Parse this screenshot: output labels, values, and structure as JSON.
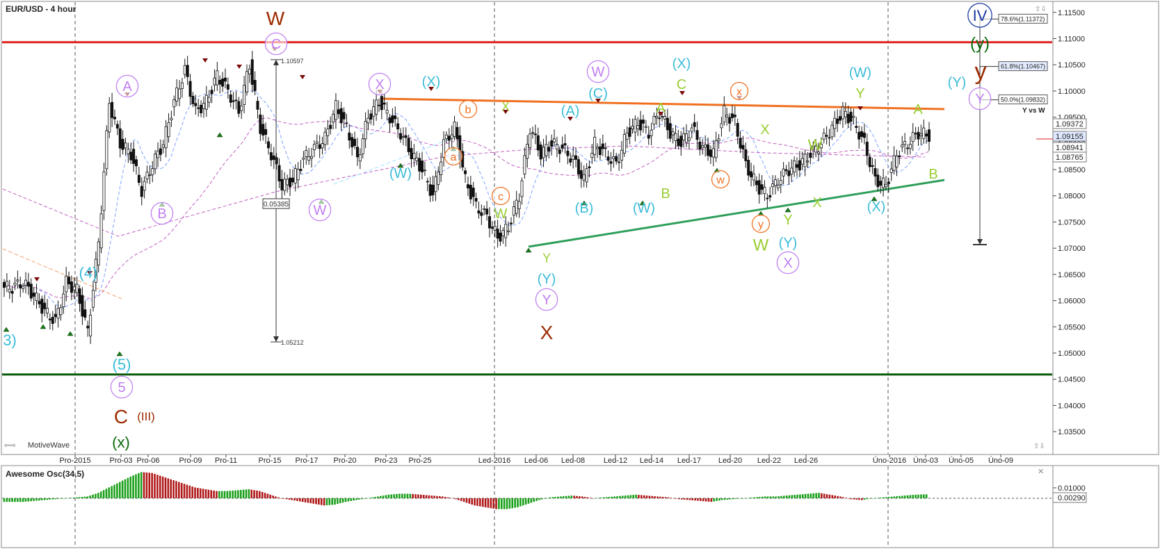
{
  "chart_data": {
    "type": "candlestick",
    "title": "EUR/USD - 4 hour",
    "watermark": "MotiveWave",
    "ylim": [
      1.0325,
      1.1155
    ],
    "y_ticks": [
      "1.11500",
      "1.11000",
      "1.10500",
      "1.10000",
      "1.09500",
      "1.09000",
      "1.08500",
      "1.08000",
      "1.07500",
      "1.07000",
      "1.06500",
      "1.06000",
      "1.05500",
      "1.05000",
      "1.04500",
      "1.04000",
      "1.03500"
    ],
    "x_ticks": [
      "Pro-2015",
      "Pro-03",
      "Pro-06",
      "Pro-09",
      "Pro-11",
      "Pro-15",
      "Pro-17",
      "Pro-20",
      "Pro-23",
      "Pro-25",
      "Led-2016",
      "Led-06",
      "Led-08",
      "Led-12",
      "Led-14",
      "Led-17",
      "Led-20",
      "Led-22",
      "Led-26",
      "Úno-2016",
      "Úno-03",
      "Úno-05",
      "Úno-09"
    ],
    "price_labels": [
      {
        "text": "1.09372",
        "color": "#ffffff"
      },
      {
        "text": "1.09155",
        "color": "#dfe8ff"
      },
      {
        "text": "1.08941",
        "color": "#ffffff"
      },
      {
        "text": "1.08765",
        "color": "#ffffff"
      }
    ],
    "fib_levels": [
      {
        "text": "78.6%(1.11372)",
        "price": 1.11372
      },
      {
        "text": "61.8%(1.10467)",
        "price": 1.10467
      },
      {
        "text": "50.0%(1.09832)",
        "price": 1.09832
      }
    ],
    "fib_caption": "Y vs W",
    "measure": {
      "high": "1.10597",
      "low": "1.05212",
      "diff": "0.05385"
    },
    "lines": [
      {
        "name": "resistance-red",
        "color": "#e02020",
        "y": 1.1093
      },
      {
        "name": "support-darkgreen",
        "color": "#0a5a0a",
        "y": 1.0459
      },
      {
        "name": "triangle-top-orange",
        "color": "#f07020",
        "from": 1.0985,
        "to": 1.0966
      },
      {
        "name": "triangle-bottom-green",
        "color": "#2e9e5a",
        "from": 1.071,
        "to": 1.0834
      }
    ],
    "closes": [
      1.0625,
      1.0635,
      1.061,
      1.058,
      1.056,
      1.0635,
      1.062,
      1.054,
      1.071,
      1.098,
      1.09,
      1.088,
      1.081,
      1.086,
      1.09,
      1.098,
      1.104,
      1.096,
      1.098,
      1.103,
      1.1,
      1.096,
      1.105,
      1.093,
      1.088,
      1.082,
      1.083,
      1.087,
      1.089,
      1.091,
      1.097,
      1.093,
      1.087,
      1.095,
      1.098,
      1.095,
      1.092,
      1.088,
      1.085,
      1.08,
      1.09,
      1.093,
      1.083,
      1.078,
      1.076,
      1.072,
      1.074,
      1.08,
      1.093,
      1.088,
      1.09,
      1.089,
      1.087,
      1.083,
      1.09,
      1.088,
      1.086,
      1.092,
      1.094,
      1.092,
      1.096,
      1.092,
      1.09,
      1.093,
      1.089,
      1.088,
      1.096,
      1.094,
      1.086,
      1.082,
      1.08,
      1.083,
      1.085,
      1.086,
      1.088,
      1.09,
      1.093,
      1.096,
      1.094,
      1.09,
      1.083,
      1.082,
      1.088,
      1.09,
      1.092,
      1.0915
    ],
    "oscillator": {
      "name": "Awesome Osc(34,5)",
      "ticks": [
        "0.01000",
        "0.00290"
      ],
      "values": [
        -0.002,
        -0.002,
        -0.0015,
        -0.001,
        -0.0005,
        0.0,
        0.0005,
        0.001,
        0.003,
        0.006,
        0.009,
        0.012,
        0.0145,
        0.014,
        0.012,
        0.01,
        0.008,
        0.006,
        0.005,
        0.004,
        0.004,
        0.0045,
        0.005,
        0.004,
        0.002,
        0.0,
        -0.001,
        -0.002,
        -0.003,
        -0.004,
        -0.0035,
        -0.002,
        -0.001,
        0.0,
        0.001,
        0.002,
        0.0025,
        0.0025,
        0.002,
        0.0015,
        0.001,
        0.0,
        -0.002,
        -0.004,
        -0.005,
        -0.006,
        -0.006,
        -0.005,
        -0.003,
        -0.001,
        0.0005,
        0.001,
        0.0015,
        0.001,
        0.0,
        0.0005,
        0.001,
        0.0015,
        0.002,
        0.0015,
        0.001,
        0.0005,
        -0.0005,
        -0.001,
        -0.0015,
        -0.002,
        -0.001,
        -0.0005,
        0.0,
        0.0005,
        0.001,
        0.001,
        0.0015,
        0.002,
        0.0025,
        0.003,
        0.002,
        0.001,
        -0.0005,
        -0.001,
        0.0,
        0.0005,
        0.001,
        0.0015,
        0.002,
        0.0022
      ]
    },
    "wave_labels": [
      {
        "text": "W",
        "color": "#9b2a00",
        "circled": false,
        "px": [
          396,
          26
        ],
        "size": 28
      },
      {
        "text": "X",
        "color": "#9b2a00",
        "circled": false,
        "px": [
          786,
          478
        ],
        "size": 28
      },
      {
        "text": "C",
        "color": "#9b2a00",
        "circled": false,
        "px": [
          174,
          599
        ],
        "size": 28
      },
      {
        "text": "(III)",
        "color": "#9b2a00",
        "circled": false,
        "px": [
          210,
          599
        ],
        "size": 17
      },
      {
        "text": "(x)",
        "color": "#0a6a0a",
        "circled": false,
        "px": [
          174,
          636
        ],
        "size": 22
      },
      {
        "text": "(y)",
        "color": "#0a6a0a",
        "circled": false,
        "px": [
          1409,
          62
        ],
        "size": 24
      },
      {
        "text": "y",
        "color": "#9b2a00",
        "circled": false,
        "px": [
          1410,
          102
        ],
        "size": 34
      },
      {
        "text": "IV",
        "color": "#1a3aa0",
        "circled": true,
        "px": [
          1409,
          22
        ],
        "size": 22
      },
      {
        "text": "3)",
        "color": "#3bbcd8",
        "circled": false,
        "px": [
          14,
          489
        ],
        "size": 22
      },
      {
        "text": "(4)",
        "color": "#3bbcd8",
        "circled": false,
        "px": [
          127,
          392
        ],
        "size": 22
      },
      {
        "text": "(5)",
        "color": "#3bbcd8",
        "circled": false,
        "px": [
          175,
          524
        ],
        "size": 22
      },
      {
        "text": "5",
        "color": "#c080f0",
        "circled": true,
        "px": [
          175,
          557
        ],
        "size": 20
      },
      {
        "text": "A",
        "color": "#c080f0",
        "circled": true,
        "px": [
          183,
          124
        ],
        "size": 20
      },
      {
        "text": "B",
        "color": "#c080f0",
        "circled": true,
        "px": [
          233,
          307
        ],
        "size": 20
      },
      {
        "text": "C",
        "color": "#c080f0",
        "circled": true,
        "px": [
          397,
          63
        ],
        "size": 20
      },
      {
        "text": "W",
        "color": "#c080f0",
        "circled": true,
        "px": [
          460,
          302
        ],
        "size": 20
      },
      {
        "text": "X",
        "color": "#c080f0",
        "circled": true,
        "px": [
          546,
          121
        ],
        "size": 20
      },
      {
        "text": "(X)",
        "color": "#3bbcd8",
        "circled": false,
        "px": [
          620,
          117
        ],
        "size": 20
      },
      {
        "text": "(W)",
        "color": "#3bbcd8",
        "circled": false,
        "px": [
          576,
          249
        ],
        "size": 20
      },
      {
        "text": "b",
        "color": "#f07020",
        "circled": true,
        "px": [
          673,
          157
        ],
        "size": 16
      },
      {
        "text": "a",
        "color": "#f07020",
        "circled": true,
        "px": [
          652,
          225
        ],
        "size": 16
      },
      {
        "text": "c",
        "color": "#f07020",
        "circled": true,
        "px": [
          720,
          282
        ],
        "size": 16
      },
      {
        "text": "X",
        "color": "#9acd32",
        "circled": false,
        "px": [
          727,
          153
        ],
        "size": 18
      },
      {
        "text": "W",
        "color": "#9acd32",
        "circled": false,
        "px": [
          720,
          307
        ],
        "size": 20
      },
      {
        "text": "Y",
        "color": "#9acd32",
        "circled": false,
        "px": [
          786,
          371
        ],
        "size": 18
      },
      {
        "text": "(Y)",
        "color": "#3bbcd8",
        "circled": false,
        "px": [
          786,
          401
        ],
        "size": 20
      },
      {
        "text": "Y",
        "color": "#c080f0",
        "circled": true,
        "px": [
          786,
          431
        ],
        "size": 20
      },
      {
        "text": "(A)",
        "color": "#3bbcd8",
        "circled": false,
        "px": [
          820,
          159
        ],
        "size": 20
      },
      {
        "text": "(B)",
        "color": "#3bbcd8",
        "circled": false,
        "px": [
          840,
          299
        ],
        "size": 20
      },
      {
        "text": "(C)",
        "color": "#3bbcd8",
        "circled": false,
        "px": [
          860,
          134
        ],
        "size": 20
      },
      {
        "text": "W",
        "color": "#c080f0",
        "circled": true,
        "px": [
          860,
          103
        ],
        "size": 20
      },
      {
        "text": "A",
        "color": "#9acd32",
        "circled": false,
        "px": [
          950,
          155
        ],
        "size": 20
      },
      {
        "text": "B",
        "color": "#9acd32",
        "circled": false,
        "px": [
          957,
          278
        ],
        "size": 20
      },
      {
        "text": "(W)",
        "color": "#3bbcd8",
        "circled": false,
        "px": [
          926,
          299
        ],
        "size": 20
      },
      {
        "text": "(X)",
        "color": "#3bbcd8",
        "circled": false,
        "px": [
          980,
          91
        ],
        "size": 20
      },
      {
        "text": "C",
        "color": "#9acd32",
        "circled": false,
        "px": [
          980,
          121
        ],
        "size": 20
      },
      {
        "text": "x",
        "color": "#f07020",
        "circled": true,
        "px": [
          1063,
          131
        ],
        "size": 16
      },
      {
        "text": "w",
        "color": "#f07020",
        "circled": true,
        "px": [
          1036,
          258
        ],
        "size": 16
      },
      {
        "text": "X",
        "color": "#9acd32",
        "circled": false,
        "px": [
          1100,
          186
        ],
        "size": 20
      },
      {
        "text": "y",
        "color": "#f07020",
        "circled": true,
        "px": [
          1094,
          322
        ],
        "size": 16
      },
      {
        "text": "W",
        "color": "#9acd32",
        "circled": false,
        "px": [
          1094,
          352
        ],
        "size": 24
      },
      {
        "text": "Y",
        "color": "#9acd32",
        "circled": false,
        "px": [
          1133,
          316
        ],
        "size": 20
      },
      {
        "text": "(Y)",
        "color": "#3bbcd8",
        "circled": false,
        "px": [
          1133,
          349
        ],
        "size": 20
      },
      {
        "text": "X",
        "color": "#c080f0",
        "circled": true,
        "px": [
          1133,
          378
        ],
        "size": 20
      },
      {
        "text": "W",
        "color": "#9acd32",
        "circled": false,
        "px": [
          1172,
          208
        ],
        "size": 22
      },
      {
        "text": "X",
        "color": "#9acd32",
        "circled": false,
        "px": [
          1175,
          291
        ],
        "size": 20
      },
      {
        "text": "(W)",
        "color": "#3bbcd8",
        "circled": false,
        "px": [
          1237,
          104
        ],
        "size": 20
      },
      {
        "text": "Y",
        "color": "#9acd32",
        "circled": false,
        "px": [
          1237,
          134
        ],
        "size": 20
      },
      {
        "text": "(X)",
        "color": "#3bbcd8",
        "circled": false,
        "px": [
          1260,
          297
        ],
        "size": 20
      },
      {
        "text": "A",
        "color": "#9acd32",
        "circled": false,
        "px": [
          1320,
          157
        ],
        "size": 20
      },
      {
        "text": "B",
        "color": "#9acd32",
        "circled": false,
        "px": [
          1342,
          250
        ],
        "size": 20
      },
      {
        "text": "(Y)",
        "color": "#3bbcd8",
        "circled": false,
        "px": [
          1376,
          118
        ],
        "size": 20
      },
      {
        "text": "Y",
        "color": "#c080f0",
        "circled": true,
        "px": [
          1409,
          142
        ],
        "size": 20
      }
    ]
  }
}
